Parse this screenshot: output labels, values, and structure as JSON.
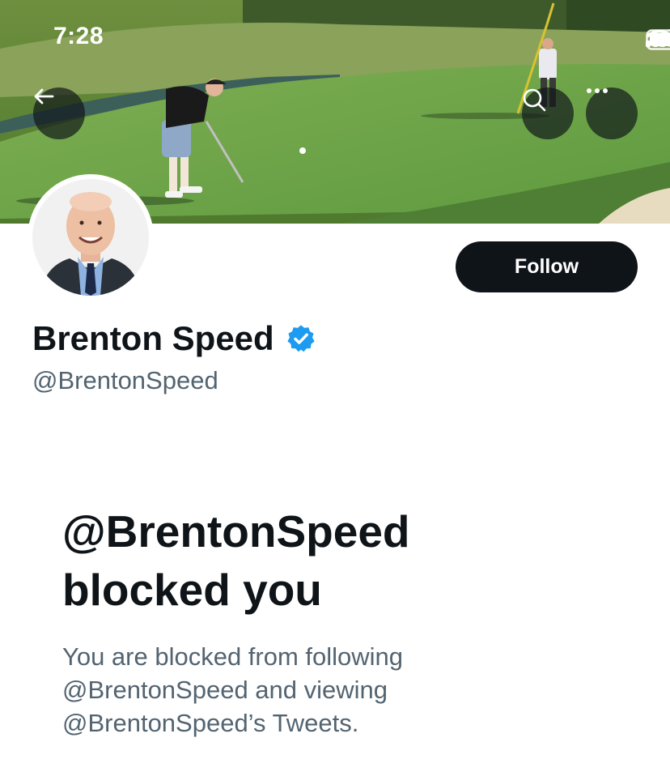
{
  "status_bar": {
    "time": "7:28",
    "icons": [
      "cellular-signal-icon",
      "wifi-icon",
      "battery-icon"
    ]
  },
  "header": {
    "back_icon": "arrow-left-icon",
    "search_icon": "search-icon",
    "more_icon": "more-horizontal-icon"
  },
  "profile": {
    "display_name": "Brenton Speed",
    "handle": "@BrentonSpeed",
    "verified": true,
    "verified_icon": "verified-badge-icon",
    "follow_label": "Follow"
  },
  "blocked": {
    "title": "@BrentonSpeed blocked you",
    "description": "You are blocked from following @BrentonSpeed and viewing @BrentonSpeed’s Tweets."
  },
  "colors": {
    "text_primary": "#0f1419",
    "text_secondary": "#536471",
    "verified_blue": "#1d9bf0",
    "button_dark": "#0f1419"
  }
}
